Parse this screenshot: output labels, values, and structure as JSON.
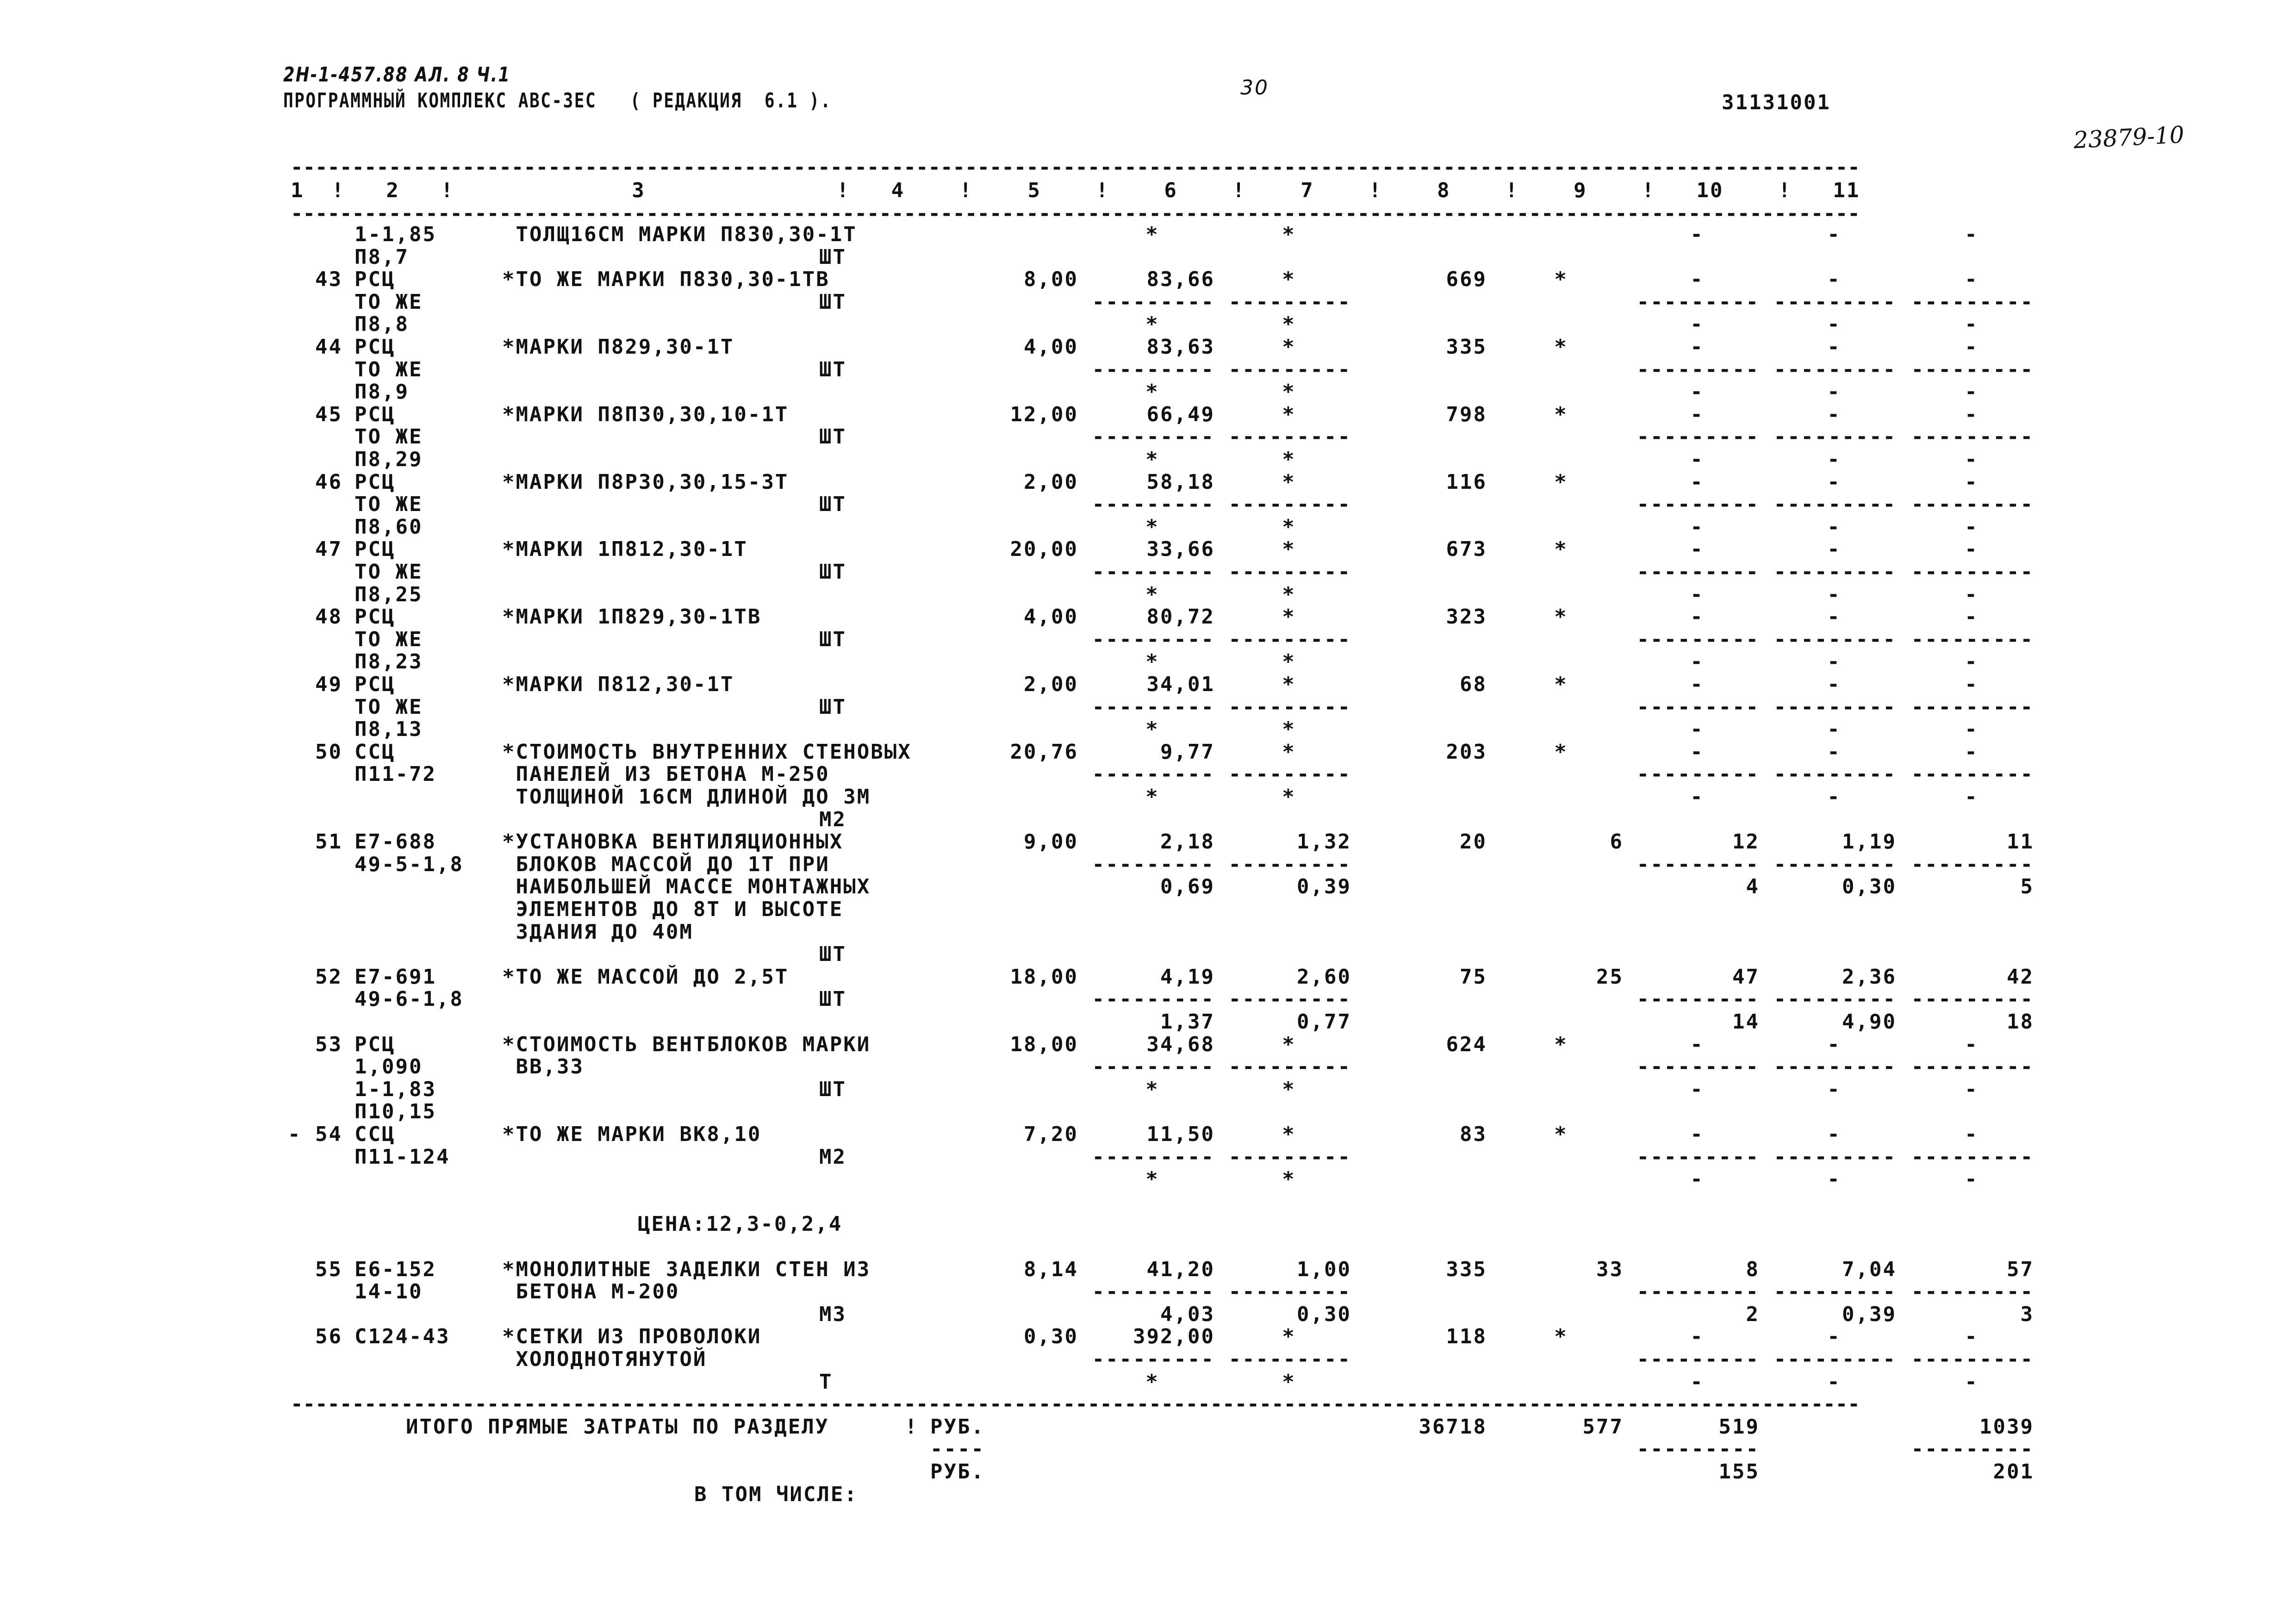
{
  "header": {
    "doc_ref": "2Н-1-457.88 АЛ. 8 Ч.1",
    "program": "ПРОГРАММНЫЙ КОМПЛЕКС АВС-3ЕС   ( РЕДАКЦИЯ  6.1 ).",
    "page": "30",
    "doc_number": "31131001",
    "handwritten_number": "23879-10"
  },
  "separator": "--------------------------------------------------------------------------------------------------------------------------------",
  "column_header": "1  !   2   !             3              !   4    !    5    !    6    !    7    !    8    !    9    !   10    !   11",
  "rows": [
    {
      "c1": "",
      "c2": "1-1,85",
      "c3": " ТОЛЩ16СМ МАРКИ П830,30-1Т",
      "c5": "*",
      "c6": "*",
      "c9": "-",
      "c10": "-",
      "c11": "-"
    },
    {
      "c2": "П8,7",
      "unit": "ШТ"
    },
    {
      "c1": "43",
      "c2": "РСЦ",
      "c3": "*ТО ЖЕ МАРКИ П830,30-1ТВ",
      "c4": "8,00",
      "c5": "83,66",
      "c6": "*",
      "c7": "669",
      "c8": "*",
      "c9": "-",
      "c10": "-",
      "c11": "-"
    },
    {
      "c2": "ТО ЖЕ",
      "unit": "ШТ",
      "c5": "---------",
      "c6": "---------",
      "c9": "---------",
      "c10": "---------",
      "c11": "---------"
    },
    {
      "c2": "П8,8",
      "c5": "*",
      "c6": "*",
      "c9": "-",
      "c10": "-",
      "c11": "-"
    },
    {
      "c1": "44",
      "c2": "РСЦ",
      "c3": "*МАРКИ П829,30-1Т",
      "c4": "4,00",
      "c5": "83,63",
      "c6": "*",
      "c7": "335",
      "c8": "*",
      "c9": "-",
      "c10": "-",
      "c11": "-"
    },
    {
      "c2": "ТО ЖЕ",
      "unit": "ШТ",
      "c5": "---------",
      "c6": "---------",
      "c9": "---------",
      "c10": "---------",
      "c11": "---------"
    },
    {
      "c2": "П8,9",
      "c5": "*",
      "c6": "*",
      "c9": "-",
      "c10": "-",
      "c11": "-"
    },
    {
      "c1": "45",
      "c2": "РСЦ",
      "c3": "*МАРКИ П8П30,30,10-1Т",
      "c4": "12,00",
      "c5": "66,49",
      "c6": "*",
      "c7": "798",
      "c8": "*",
      "c9": "-",
      "c10": "-",
      "c11": "-"
    },
    {
      "c2": "ТО ЖЕ",
      "unit": "ШТ",
      "c5": "---------",
      "c6": "---------",
      "c9": "---------",
      "c10": "---------",
      "c11": "---------"
    },
    {
      "c2": "П8,29",
      "c5": "*",
      "c6": "*",
      "c9": "-",
      "c10": "-",
      "c11": "-"
    },
    {
      "c1": "46",
      "c2": "РСЦ",
      "c3": "*МАРКИ П8Р30,30,15-3Т",
      "c4": "2,00",
      "c5": "58,18",
      "c6": "*",
      "c7": "116",
      "c8": "*",
      "c9": "-",
      "c10": "-",
      "c11": "-"
    },
    {
      "c2": "ТО ЖЕ",
      "unit": "ШТ",
      "c5": "---------",
      "c6": "---------",
      "c9": "---------",
      "c10": "---------",
      "c11": "---------"
    },
    {
      "c2": "П8,60",
      "c5": "*",
      "c6": "*",
      "c9": "-",
      "c10": "-",
      "c11": "-"
    },
    {
      "c1": "47",
      "c2": "РСЦ",
      "c3": "*МАРКИ 1П812,30-1Т",
      "c4": "20,00",
      "c5": "33,66",
      "c6": "*",
      "c7": "673",
      "c8": "*",
      "c9": "-",
      "c10": "-",
      "c11": "-"
    },
    {
      "c2": "ТО ЖЕ",
      "unit": "ШТ",
      "c5": "---------",
      "c6": "---------",
      "c9": "---------",
      "c10": "---------",
      "c11": "---------"
    },
    {
      "c2": "П8,25",
      "c5": "*",
      "c6": "*",
      "c9": "-",
      "c10": "-",
      "c11": "-"
    },
    {
      "c1": "48",
      "c2": "РСЦ",
      "c3": "*МАРКИ 1П829,30-1ТВ",
      "c4": "4,00",
      "c5": "80,72",
      "c6": "*",
      "c7": "323",
      "c8": "*",
      "c9": "-",
      "c10": "-",
      "c11": "-"
    },
    {
      "c2": "ТО ЖЕ",
      "unit": "ШТ",
      "c5": "---------",
      "c6": "---------",
      "c9": "---------",
      "c10": "---------",
      "c11": "---------"
    },
    {
      "c2": "П8,23",
      "c5": "*",
      "c6": "*",
      "c9": "-",
      "c10": "-",
      "c11": "-"
    },
    {
      "c1": "49",
      "c2": "РСЦ",
      "c3": "*МАРКИ П812,30-1Т",
      "c4": "2,00",
      "c5": "34,01",
      "c6": "*",
      "c7": "68",
      "c8": "*",
      "c9": "-",
      "c10": "-",
      "c11": "-"
    },
    {
      "c2": "ТО ЖЕ",
      "unit": "ШТ",
      "c5": "---------",
      "c6": "---------",
      "c9": "---------",
      "c10": "---------",
      "c11": "---------"
    },
    {
      "c2": "П8,13",
      "c5": "*",
      "c6": "*",
      "c9": "-",
      "c10": "-",
      "c11": "-"
    },
    {
      "c1": "50",
      "c2": "ССЦ",
      "c3": "*СТОИМОСТЬ ВНУТРЕННИХ СТЕНОВЫХ",
      "c4": "20,76",
      "c5": "9,77",
      "c6": "*",
      "c7": "203",
      "c8": "*",
      "c9": "-",
      "c10": "-",
      "c11": "-"
    },
    {
      "c2": "П11-72",
      "c3": " ПАНЕЛЕЙ ИЗ БЕТОНА М-250",
      "c5": "---------",
      "c6": "---------",
      "c9": "---------",
      "c10": "---------",
      "c11": "---------"
    },
    {
      "c3": " ТОЛЩИНОЙ 16СМ ДЛИНОЙ ДО 3М",
      "c5": "*",
      "c6": "*",
      "c9": "-",
      "c10": "-",
      "c11": "-"
    },
    {
      "unit": "М2"
    },
    {
      "c1": "51",
      "c2": "Е7-688",
      "c3": "*УСТАНОВКА ВЕНТИЛЯЦИОННЫХ",
      "c4": "9,00",
      "c5": "2,18",
      "c6": "1,32",
      "c7": "20",
      "c8": "6",
      "c9": "12",
      "c10": "1,19",
      "c11": "11"
    },
    {
      "c2": "49-5-1,8",
      "c3": " БЛОКОВ МАССОЙ ДО 1Т ПРИ",
      "c5": "---------",
      "c6": "---------",
      "c9": "---------",
      "c10": "---------",
      "c11": "---------"
    },
    {
      "c3": " НАИБОЛЬШЕЙ МАССЕ МОНТАЖНЫХ",
      "c5": "0,69",
      "c6": "0,39",
      "c9": "4",
      "c10": "0,30",
      "c11": "5"
    },
    {
      "c3": " ЭЛЕМЕНТОВ ДО 8Т И ВЫСОТЕ"
    },
    {
      "c3": " ЗДАНИЯ ДО 40М"
    },
    {
      "unit": "ШТ"
    },
    {
      "c1": "52",
      "c2": "Е7-691",
      "c3": "*ТО ЖЕ МАССОЙ ДО 2,5Т",
      "c4": "18,00",
      "c5": "4,19",
      "c6": "2,60",
      "c7": "75",
      "c8": "25",
      "c9": "47",
      "c10": "2,36",
      "c11": "42"
    },
    {
      "c2": "49-6-1,8",
      "unit": "ШТ",
      "c5": "---------",
      "c6": "---------",
      "c9": "---------",
      "c10": "---------",
      "c11": "---------"
    },
    {
      "c5": "1,37",
      "c6": "0,77",
      "c9": "14",
      "c10": "4,90",
      "c11": "18"
    },
    {
      "c1": "53",
      "c2": "РСЦ",
      "c3": "*СТОИМОСТЬ ВЕНТБЛОКОВ МАРКИ",
      "c4": "18,00",
      "c5": "34,68",
      "c6": "*",
      "c7": "624",
      "c8": "*",
      "c9": "-",
      "c10": "-",
      "c11": "-"
    },
    {
      "c2": "1,090",
      "c3": " ВВ,33",
      "c5": "---------",
      "c6": "---------",
      "c9": "---------",
      "c10": "---------",
      "c11": "---------"
    },
    {
      "c2": "1-1,83",
      "unit": "ШТ",
      "c5": "*",
      "c6": "*",
      "c9": "-",
      "c10": "-",
      "c11": "-"
    },
    {
      "c2": "П10,15"
    },
    {
      "c1": "- 54",
      "c2": "ССЦ",
      "c3": "*ТО ЖЕ МАРКИ ВК8,10",
      "c4": "7,20",
      "c5": "11,50",
      "c6": "*",
      "c7": "83",
      "c8": "*",
      "c9": "-",
      "c10": "-",
      "c11": "-"
    },
    {
      "c2": "П11-124",
      "unit": "М2",
      "c5": "---------",
      "c6": "---------",
      "c9": "---------",
      "c10": "---------",
      "c11": "---------"
    },
    {
      "c5": "*",
      "c6": "*",
      "c9": "-",
      "c10": "-",
      "c11": "-"
    },
    {},
    {
      "note": "ЦЕНА:12,3-0,2,4"
    },
    {},
    {
      "c1": "55",
      "c2": "Е6-152",
      "c3": "*МОНОЛИТНЫЕ ЗАДЕЛКИ СТЕН ИЗ",
      "c4": "8,14",
      "c5": "41,20",
      "c6": "1,00",
      "c7": "335",
      "c8": "33",
      "c9": "8",
      "c10": "7,04",
      "c11": "57"
    },
    {
      "c2": "14-10",
      "c3": " БЕТОНА М-200",
      "c5": "---------",
      "c6": "---------",
      "c9": "---------",
      "c10": "---------",
      "c11": "---------"
    },
    {
      "unit": "М3",
      "c5": "4,03",
      "c6": "0,30",
      "c9": "2",
      "c10": "0,39",
      "c11": "3"
    },
    {
      "c1": "56",
      "c2": "С124-43",
      "c3": "*СЕТКИ ИЗ ПРОВОЛОКИ",
      "c4": "0,30",
      "c5": "392,00",
      "c6": "*",
      "c7": "118",
      "c8": "*",
      "c9": "-",
      "c10": "-",
      "c11": "-"
    },
    {
      "c3": " ХОЛОДНОТЯНУТОЙ",
      "c5": "---------",
      "c6": "---------",
      "c9": "---------",
      "c10": "---------",
      "c11": "---------"
    },
    {
      "unit": "Т",
      "c5": "*",
      "c6": "*",
      "c9": "-",
      "c10": "-",
      "c11": "-"
    },
    {
      "sep": true
    },
    {
      "total": "ИТОГО ПРЯМЫЕ ЗАТРАТЫ ПО РАЗДЕЛУ",
      "bang": "!",
      "rub": "РУБ.",
      "c7": "36718",
      "c8": "577",
      "c9": "519",
      "c11": "1039"
    },
    {
      "rub": "----",
      "c9": "---------",
      "c11": "---------"
    },
    {
      "rub": "РУБ.",
      "c9": "155",
      "c11": "201"
    },
    {
      "vtom": "В ТОМ ЧИСЛЕ:"
    }
  ]
}
